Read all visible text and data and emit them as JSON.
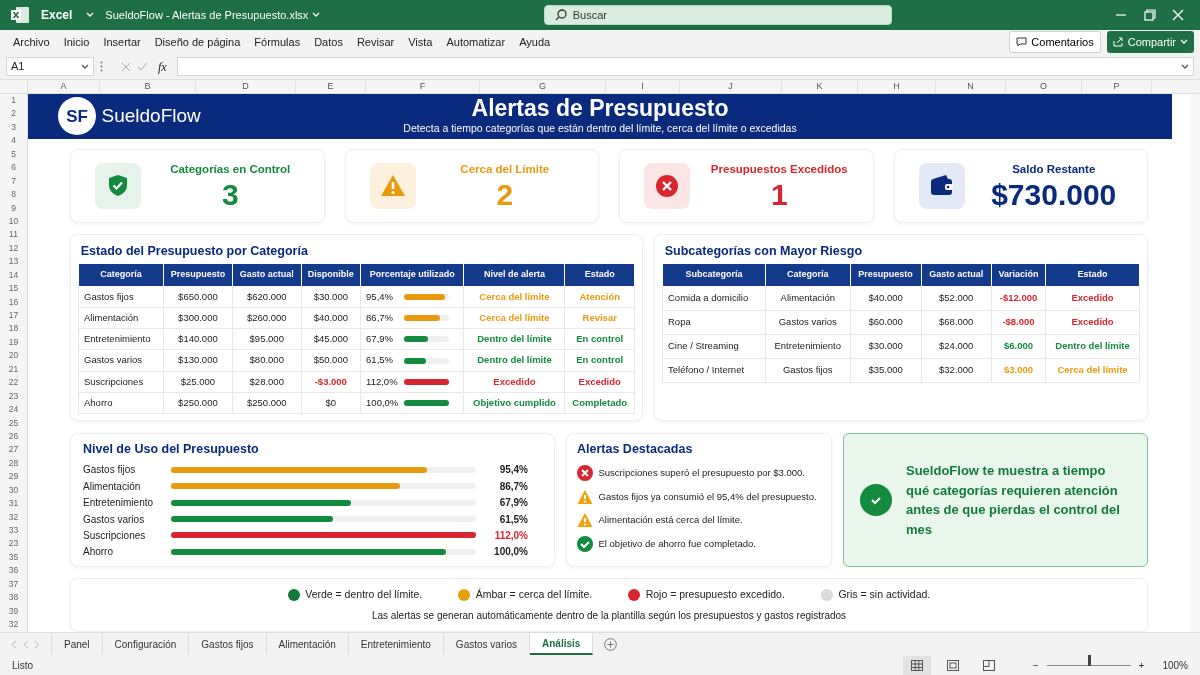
{
  "window": {
    "app": "Excel",
    "title": "SueldoFlow - Alertas de Presupuesto.xlsx",
    "search_placeholder": "Buscar"
  },
  "menu": [
    "Archivo",
    "Inicio",
    "Insertar",
    "Diseño de página",
    "Fórmulas",
    "Datos",
    "Revisar",
    "Vista",
    "Automatizar",
    "Ayuda"
  ],
  "comments_button": "Comentarios",
  "share_button": "Compartir",
  "formula_bar": {
    "cell_ref": "A1",
    "fx": "fx"
  },
  "column_headers": [
    "A",
    "B",
    "D",
    "E",
    "F",
    "G",
    "I",
    "J",
    "K",
    "H",
    "N",
    "O",
    "P"
  ],
  "row_numbers": [
    "1",
    "2",
    "3",
    "4",
    "5",
    "6",
    "7",
    "8",
    "9",
    "10",
    "11",
    "12",
    "13",
    "14",
    "15",
    "16",
    "17",
    "18",
    "19",
    "20",
    "21",
    "22",
    "23",
    "24",
    "25",
    "26",
    "27",
    "28",
    "29",
    "30",
    "31",
    "32",
    "33",
    "23",
    "35",
    "36",
    "37",
    "38",
    "39",
    "32"
  ],
  "banner": {
    "logo_mark": "SF",
    "logo_text": "SueldoFlow",
    "title": "Alertas de Presupuesto",
    "subtitle": "Detecta a tiempo categorías que están dentro del límite, cerca del límite o excedidas"
  },
  "kpis": [
    {
      "kind": "ok",
      "label": "Categorías en Control",
      "value": "3"
    },
    {
      "kind": "warning",
      "label": "Cerca del Límite",
      "value": "2"
    },
    {
      "kind": "danger",
      "label": "Presupuestos Excedidos",
      "value": "1"
    },
    {
      "kind": "balance",
      "label": "Saldo Restante",
      "value": "$730.000"
    }
  ],
  "budget_table": {
    "title": "Estado del Presupuesto por Categoría",
    "columns": [
      "Categoría",
      "Presupuesto",
      "Gasto actual",
      "Disponible",
      "Porcentaje utilizado",
      "Nivel de alerta",
      "Estado"
    ],
    "rows": [
      {
        "category": "Gastos fijos",
        "budget": "$650.000",
        "spent": "$620.000",
        "available": "$30.000",
        "available_negative": false,
        "percent": "95,4%",
        "level": 0.91,
        "kind": "warning",
        "alert": "Cerca del límite",
        "status": "Atención"
      },
      {
        "category": "Alimentación",
        "budget": "$300.000",
        "spent": "$260.000",
        "available": "$40.000",
        "available_negative": false,
        "percent": "86,7%",
        "level": 0.8,
        "kind": "warning",
        "alert": "Cerca del límite",
        "status": "Revisar"
      },
      {
        "category": "Entretenimiento",
        "budget": "$140.000",
        "spent": "$95.000",
        "available": "$45.000",
        "available_negative": false,
        "percent": "67,9%",
        "level": 0.55,
        "kind": "ok",
        "alert": "Dentro del límite",
        "status": "En control"
      },
      {
        "category": "Gastos varios",
        "budget": "$130.000",
        "spent": "$80.000",
        "available": "$50.000",
        "available_negative": false,
        "percent": "61,5%",
        "level": 0.49,
        "kind": "ok",
        "alert": "Dentro del límite",
        "status": "En control"
      },
      {
        "category": "Suscripciones",
        "budget": "$25.000",
        "spent": "$28.000",
        "available": "-$3.000",
        "available_negative": true,
        "percent": "112,0%",
        "level": 1,
        "kind": "danger",
        "alert": "Excedido",
        "status": "Excedido"
      },
      {
        "category": "Ahorro",
        "budget": "$250.000",
        "spent": "$250.000",
        "available": "$0",
        "available_negative": false,
        "percent": "100,0%",
        "level": 1,
        "kind": "ok",
        "alert": "Objetivo cumplido",
        "status": "Completado"
      }
    ]
  },
  "risk_table": {
    "title": "Subcategorías con Mayor Riesgo",
    "columns": [
      "Subcategoría",
      "Categoría",
      "Presupuesto",
      "Gasto actual",
      "Variación",
      "Estado"
    ],
    "rows": [
      {
        "subcategory": "Comida a domicilio",
        "category": "Alimentación",
        "budget": "$40.000",
        "spent": "$52.000",
        "variation": "-$12.000",
        "kind": "danger",
        "status": "Excedido"
      },
      {
        "subcategory": "Ropa",
        "category": "Gastos varios",
        "budget": "$60.000",
        "spent": "$68.000",
        "variation": "-$8.000",
        "kind": "danger",
        "status": "Excedido"
      },
      {
        "subcategory": "Cine / Streaming",
        "category": "Entretenimiento",
        "budget": "$30.000",
        "spent": "$24.000",
        "variation": "$6.000",
        "kind": "ok",
        "status": "Dentro del límite"
      },
      {
        "subcategory": "Teléfono / Internet",
        "category": "Gastos fijos",
        "budget": "$35.000",
        "spent": "$32.000",
        "variation": "$3.000",
        "kind": "warning",
        "status": "Cerca del límite"
      }
    ]
  },
  "usage": {
    "title": "Nivel de Uso del Presupuesto",
    "bars": [
      {
        "label": "Gastos fijos",
        "level": 0.84,
        "kind": "warning",
        "reading": "95,4%"
      },
      {
        "label": "Alimentación",
        "level": 0.75,
        "kind": "warning",
        "reading": "86,7%"
      },
      {
        "label": "Entretenimiento",
        "level": 0.59,
        "kind": "ok",
        "reading": "67,9%"
      },
      {
        "label": "Gastos varios",
        "level": 0.53,
        "kind": "ok",
        "reading": "61,5%"
      },
      {
        "label": "Suscripciones",
        "level": 1,
        "kind": "danger",
        "reading": "112,0%"
      },
      {
        "label": "Ahorro",
        "level": 0.9,
        "kind": "ok",
        "reading": "100,0%"
      }
    ]
  },
  "alerts": {
    "title": "Alertas Destacadas",
    "items": [
      {
        "kind": "danger",
        "text": "Suscripciones superó el presupuesto por $3.000."
      },
      {
        "kind": "warning",
        "text": "Gastos fijos ya consumió el 95,4% del presupuesto."
      },
      {
        "kind": "warning",
        "text": "Alimentación está cerca del límite."
      },
      {
        "kind": "ok",
        "text": "El objetivo de ahorro fue completado."
      }
    ]
  },
  "callout": {
    "text": "SueldoFlow te muestra a tiempo qué categorías requieren atención antes de que pierdas el control del mes"
  },
  "legend": {
    "items": [
      {
        "label": "Verde = dentro del límite.",
        "color": "#127a3a"
      },
      {
        "label": "Ámbar = cerca del límite.",
        "color": "#e8a10e"
      },
      {
        "label": "Rojo = presupuesto excedido.",
        "color": "#d7262f"
      },
      {
        "label": "Gris = sin actividad.",
        "color": "#d9d9d9"
      }
    ],
    "note": "Las alertas se generan automáticamente dentro de la plantilla según los presupuestos y gastos registrados"
  },
  "sheet_tabs": [
    {
      "label": "Panel",
      "selected": false
    },
    {
      "label": "Configuración",
      "selected": false
    },
    {
      "label": "Gastos fijos",
      "selected": false
    },
    {
      "label": "Alimentación",
      "selected": false
    },
    {
      "label": "Entretenimiento",
      "selected": false
    },
    {
      "label": "Gastos varios",
      "selected": false
    },
    {
      "label": "Análisis",
      "selected": true
    }
  ],
  "status_bar": {
    "ready": "Listo",
    "zoom_out": "−",
    "zoom_in": "+",
    "level": 0.5,
    "zoom": "100%"
  }
}
